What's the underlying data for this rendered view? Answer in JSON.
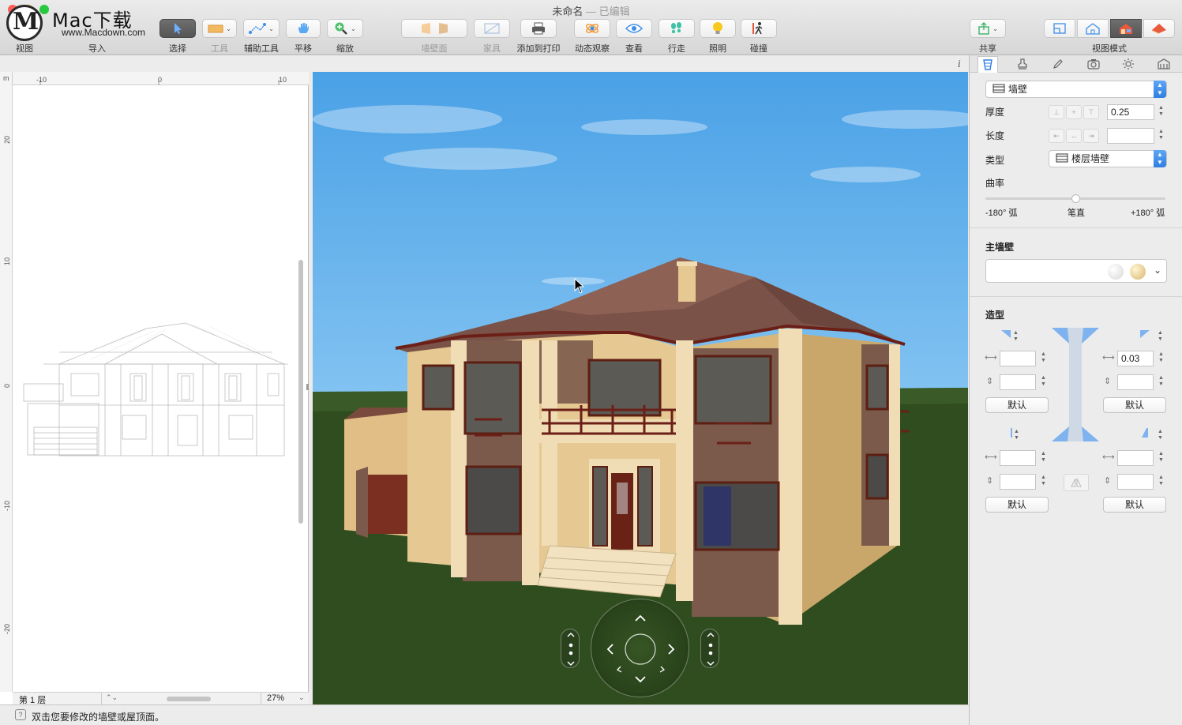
{
  "window": {
    "title": "未命名",
    "title_suffix": " — 已编辑"
  },
  "logo": {
    "text": "Mac下载",
    "url": "www.Macdown.com"
  },
  "toolbar": {
    "view": "视图",
    "import": "导入",
    "select": "选择",
    "tools": "工具",
    "aux_tools": "辅助工具",
    "pan": "平移",
    "zoom": "缩放",
    "wall_face": "墙壁面",
    "furniture": "家具",
    "add_to_print": "添加到打印",
    "orbit": "动态观察",
    "look": "查看",
    "walk": "行走",
    "lighting": "照明",
    "collision": "碰撞",
    "share": "共享",
    "view_mode": "视图模式"
  },
  "plan": {
    "ruler_top": [
      "-10",
      "0",
      "10"
    ],
    "ruler_left": [
      "20",
      "10",
      "0",
      "-10",
      "-20"
    ],
    "ruler_unit": "m",
    "level": "第 1 层",
    "zoom": "27%"
  },
  "inspector": {
    "object_type": "墙壁",
    "thickness_label": "厚度",
    "thickness_value": "0.25",
    "length_label": "长度",
    "length_value": "",
    "type_label": "类型",
    "type_value": "楼层墙壁",
    "curvature_label": "曲率",
    "curvature_value": 0.5,
    "curve_min": "-180° 弧",
    "curve_mid": "笔直",
    "curve_max": "+180° 弧",
    "main_wall_title": "主墙壁",
    "shape_title": "造型",
    "top_right_width": "0.03",
    "default_label": "默认"
  },
  "statusbar": {
    "hint": "双击您要修改的墙壁或屋顶面。"
  },
  "info_icon": "i",
  "colors": {
    "accent": "#2f7fe3",
    "sky": "#4aa1e6",
    "grass": "#2f4d1e",
    "roof": "#7a5248",
    "stucco": "#e3c58e",
    "brick": "#7b5a4c"
  }
}
